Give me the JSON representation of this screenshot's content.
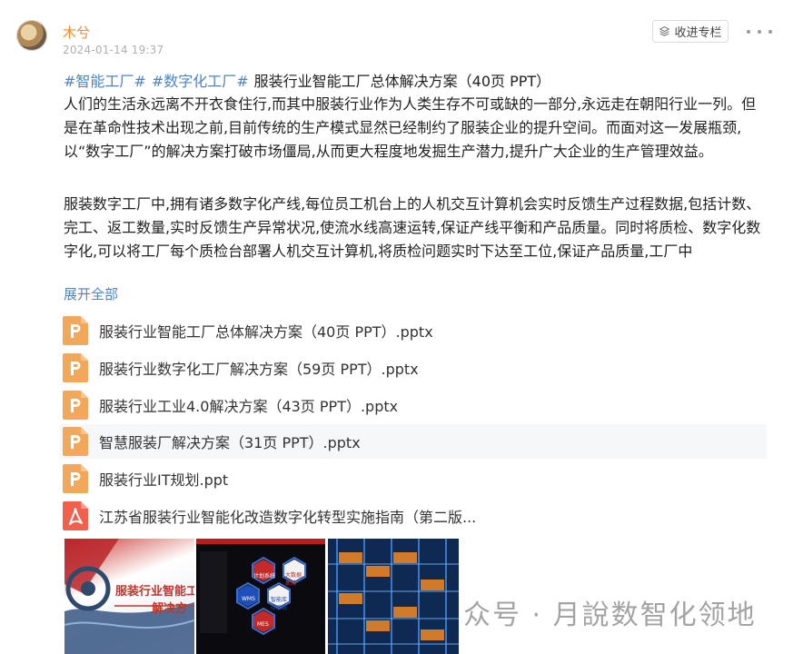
{
  "post": {
    "author": "木兮",
    "timestamp": "2024-01-14 19:37",
    "collect_label": "收进专栏",
    "hashtags": [
      "#智能工厂#",
      "#数字化工厂#"
    ],
    "title": "服装行业智能工厂总体解决方案（40页 PPT）",
    "paragraph1": "人们的生活永远离不开衣食住行,而其中服装行业作为人类生存不可或缺的一部分,永远走在朝阳行业一列。但是在革命性技术出现之前,目前传统的生产模式显然已经制约了服装企业的提升空间。而面对这一发展瓶颈,以“数字工厂”的解决方案打破市场僵局,从而更大程度地发掘生产潜力,提升广大企业的生产管理效益。",
    "paragraph2": "服装数字工厂中,拥有诸多数字化产线,每位员工机台上的人机交互计算机会实时反馈生产过程数据,包括计数、完工、返工数量,实时反馈生产异常状况,使流水线高速运转,保证产线平衡和产品质量。同时将质检、数字化数字化,可以将工厂每个质检台部署人机交互计算机,将质检问题实时下达至工位,保证产品质量,工厂中",
    "expand_label": "展开全部"
  },
  "attachments": [
    {
      "name": "服装行业智能工厂总体解决方案（40页 PPT）.pptx",
      "type": "ppt"
    },
    {
      "name": "服装行业数字化工厂解决方案（59页 PPT）.pptx",
      "type": "ppt"
    },
    {
      "name": "服装行业工业4.0解决方案（43页 PPT）.pptx",
      "type": "ppt"
    },
    {
      "name": "智慧服装厂解决方案（31页 PPT）.pptx",
      "type": "ppt"
    },
    {
      "name": "服装行业IT规划.ppt",
      "type": "ppt"
    },
    {
      "name": "江苏省服装行业智能化改造数字化转型实施指南（第二版...",
      "type": "pdf"
    }
  ],
  "thumbnails": {
    "thumb1_text": "服装行业智能工",
    "thumb1_text2": "解决方",
    "thumb2_labels": [
      "计划系统",
      "大数据集成",
      "WMS",
      "智能库存系统",
      "WMS",
      "MES"
    ]
  },
  "watermark": "众号 · 月說数智化领地",
  "colors": {
    "accent_orange": "#f08a2c",
    "link_blue": "#4e84c4",
    "ppt_icon": "#f2a85a",
    "pdf_icon": "#f0604d"
  },
  "icons": {
    "collect": "layers-icon",
    "more": "more-dots-icon",
    "ppt": "ppt-file-icon",
    "pdf": "pdf-file-icon"
  }
}
